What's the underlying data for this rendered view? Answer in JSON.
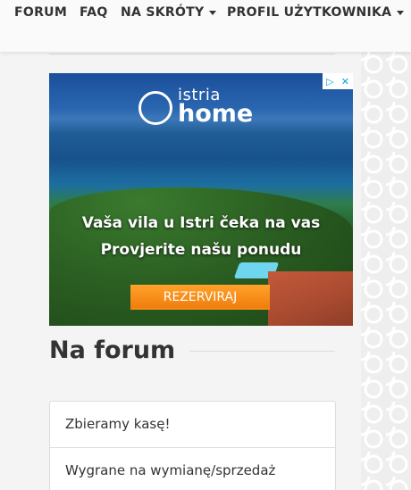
{
  "nav": {
    "items": [
      {
        "label": "FORUM",
        "dropdown": false
      },
      {
        "label": "FAQ",
        "dropdown": false
      },
      {
        "label": "NA SKRÓTY",
        "dropdown": true
      },
      {
        "label": "PROFIL UŻYTKOWNIKA",
        "dropdown": true
      }
    ]
  },
  "ad": {
    "logo_line1": "istria",
    "logo_line2": "home",
    "headline": "Vaša vila u Istri čeka na vas",
    "subline": "Provjerite našu ponudu",
    "button_label": "REZERVIRAJ",
    "controls": {
      "info_icon": "adchoices-icon",
      "close_icon": "close-icon",
      "info_glyph": "▷",
      "close_glyph": "✕"
    },
    "accent_color": "#f28a14"
  },
  "section": {
    "title": "Na forum",
    "items": [
      {
        "label": "Zbieramy kasę!"
      },
      {
        "label": "Wygrane na wymianę/sprzedaż"
      }
    ]
  }
}
